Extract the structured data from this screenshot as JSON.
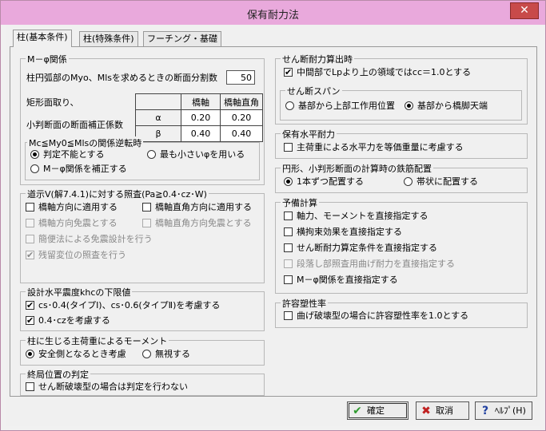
{
  "window": {
    "title": "保有耐力法",
    "close_glyph": "✕"
  },
  "tabs": [
    "柱(基本条件)",
    "柱(特殊条件)",
    "フーチング・基礎"
  ],
  "left": {
    "mphi": {
      "legend": "M－φ関係",
      "divide_label": "柱円弧部のMyo、Mlsを求めるときの断面分割数",
      "divide_value": "50",
      "rect_label": "矩形面取り、",
      "small_label": "小判断面の断面補正係数",
      "table": {
        "headers": [
          "橋軸",
          "橋軸直角"
        ],
        "rows": [
          {
            "sym": "α",
            "v1": "0.20",
            "v2": "0.20"
          },
          {
            "sym": "β",
            "v1": "0.40",
            "v2": "0.40"
          }
        ]
      },
      "reverse_legend": "Mc≦My0≦Mlsの関係逆転時",
      "r_judge": "判定不能とする",
      "r_min": "最も小さいφを用いる",
      "r_correct": "M－φ関係を補正する"
    },
    "road": {
      "legend": "道示Ⅴ(解7.4.1)に対する照査(Pa≧0.4･cz･W)",
      "c1": "橋軸方向に適用する",
      "c2": "橋軸直角方向に適用する",
      "c3": "橋軸方向免震とする",
      "c4": "橋軸直角方向免震とする",
      "c5": "簡便法による免震設計を行う",
      "c6": "残留変位の照査を行う"
    },
    "khc": {
      "legend": "設計水平震度khcの下限値",
      "c1": "cs･0.4(タイプⅠ)、cs･0.6(タイプⅡ)を考慮する",
      "c2": "0.4･czを考慮する"
    },
    "moment": {
      "legend": "柱に生じる主荷重によるモーメント",
      "r1": "安全側となるとき考慮",
      "r2": "無視する"
    },
    "final": {
      "legend": "終局位置の判定",
      "c1": "せん断破壊型の場合は判定を行わない"
    }
  },
  "right": {
    "shear": {
      "legend": "せん断耐力算出時",
      "c1": "中間部でLpより上の領域ではcc＝1.0とする",
      "span_legend": "せん断スパン",
      "r1": "基部から上部工作用位置",
      "r2": "基部から橋脚天端"
    },
    "horiz": {
      "legend": "保有水平耐力",
      "c1": "主荷重による水平力を等価重量に考慮する"
    },
    "rebar": {
      "legend": "円形、小判形断面の計算時の鉄筋配置",
      "r1": "1本ずつ配置する",
      "r2": "帯状に配置する"
    },
    "prelim": {
      "legend": "予備計算",
      "c1": "軸力、モーメントを直接指定する",
      "c2": "横拘束効果を直接指定する",
      "c3": "せん断耐力算定条件を直接指定する",
      "c4": "段落し部照査用曲げ耐力を直接指定する",
      "c5": "M－φ関係を直接指定する"
    },
    "plastic": {
      "legend": "許容塑性率",
      "c1": "曲げ破壊型の場合に許容塑性率を1.0とする"
    }
  },
  "buttons": {
    "ok": "確定",
    "cancel": "取消",
    "help": "ﾍﾙﾌﾟ(H)",
    "ok_icon": "✔",
    "cancel_icon": "✖",
    "help_icon": "?"
  },
  "colors": {
    "titlebar": "#e9a9dc",
    "close": "#c84a4a",
    "ok_icon": "#2e9a2e",
    "cancel_icon": "#c02020",
    "help_icon": "#2040a0"
  }
}
